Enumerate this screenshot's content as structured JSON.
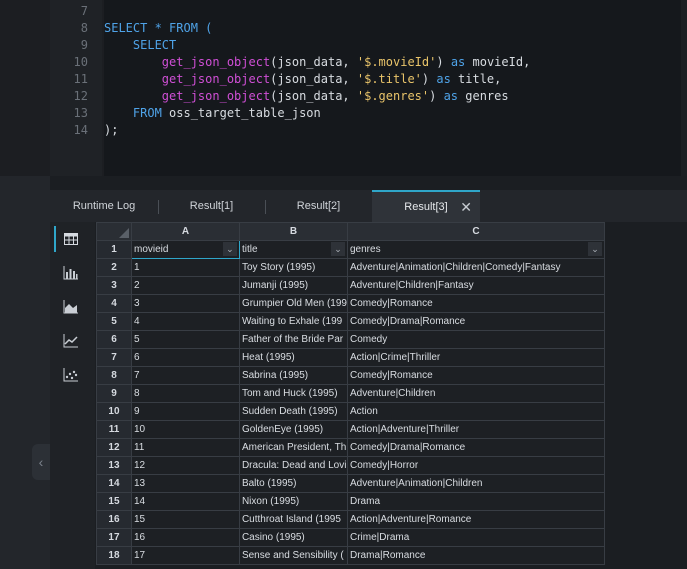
{
  "editor": {
    "line_numbers": [
      "7",
      "8",
      "9",
      "10",
      "11",
      "12",
      "13",
      "14"
    ],
    "lines": [
      [],
      [
        {
          "t": "SELECT * FROM (",
          "c": "kw"
        }
      ],
      [
        {
          "t": "    SELECT",
          "c": "kw"
        }
      ],
      [
        {
          "t": "        ",
          "c": ""
        },
        {
          "t": "get_json_object",
          "c": "fn"
        },
        {
          "t": "(json_data, ",
          "c": ""
        },
        {
          "t": "'$.movieId'",
          "c": "str"
        },
        {
          "t": ") ",
          "c": ""
        },
        {
          "t": "as",
          "c": "kw"
        },
        {
          "t": " movieId,",
          "c": ""
        }
      ],
      [
        {
          "t": "        ",
          "c": ""
        },
        {
          "t": "get_json_object",
          "c": "fn"
        },
        {
          "t": "(json_data, ",
          "c": ""
        },
        {
          "t": "'$.title'",
          "c": "str"
        },
        {
          "t": ") ",
          "c": ""
        },
        {
          "t": "as",
          "c": "kw"
        },
        {
          "t": " title,",
          "c": ""
        }
      ],
      [
        {
          "t": "        ",
          "c": ""
        },
        {
          "t": "get_json_object",
          "c": "fn"
        },
        {
          "t": "(json_data, ",
          "c": ""
        },
        {
          "t": "'$.genres'",
          "c": "str"
        },
        {
          "t": ") ",
          "c": ""
        },
        {
          "t": "as",
          "c": "kw"
        },
        {
          "t": " genres",
          "c": ""
        }
      ],
      [
        {
          "t": "    FROM",
          "c": "kw"
        },
        {
          "t": " oss_target_table_json",
          "c": ""
        }
      ],
      [
        {
          "t": ");",
          "c": ""
        }
      ]
    ]
  },
  "tabs": [
    {
      "label": "Runtime Log",
      "active": false
    },
    {
      "label": "Result[1]",
      "active": false
    },
    {
      "label": "Result[2]",
      "active": false
    },
    {
      "label": "Result[3]",
      "active": true
    }
  ],
  "tab_close_glyph": "✕",
  "side_tools": [
    "table-view-icon",
    "bar-chart-icon",
    "area-chart-icon",
    "line-chart-icon",
    "scatter-chart-icon"
  ],
  "grid": {
    "column_letters": [
      "A",
      "B",
      "C"
    ],
    "headers": [
      "movieid",
      "title",
      "genres"
    ],
    "dropdown_glyph": "⌄",
    "rows": [
      [
        "1",
        "Toy Story (1995)",
        "Adventure|Animation|Children|Comedy|Fantasy"
      ],
      [
        "2",
        "Jumanji (1995)",
        "Adventure|Children|Fantasy"
      ],
      [
        "3",
        "Grumpier Old Men (199",
        "Comedy|Romance"
      ],
      [
        "4",
        "Waiting to Exhale (199",
        "Comedy|Drama|Romance"
      ],
      [
        "5",
        "Father of the Bride Par",
        "Comedy"
      ],
      [
        "6",
        "Heat (1995)",
        "Action|Crime|Thriller"
      ],
      [
        "7",
        "Sabrina (1995)",
        "Comedy|Romance"
      ],
      [
        "8",
        "Tom and Huck (1995)",
        "Adventure|Children"
      ],
      [
        "9",
        "Sudden Death (1995)",
        "Action"
      ],
      [
        "10",
        "GoldenEye (1995)",
        "Action|Adventure|Thriller"
      ],
      [
        "11",
        "American President, Th",
        "Comedy|Drama|Romance"
      ],
      [
        "12",
        "Dracula: Dead and Lovi",
        "Comedy|Horror"
      ],
      [
        "13",
        "Balto (1995)",
        "Adventure|Animation|Children"
      ],
      [
        "14",
        "Nixon (1995)",
        "Drama"
      ],
      [
        "15",
        "Cutthroat Island (1995",
        "Action|Adventure|Romance"
      ],
      [
        "16",
        "Casino (1995)",
        "Crime|Drama"
      ],
      [
        "17",
        "Sense and Sensibility (",
        "Drama|Romance"
      ]
    ],
    "row_numbers": [
      "1",
      "2",
      "3",
      "4",
      "5",
      "6",
      "7",
      "8",
      "9",
      "10",
      "11",
      "12",
      "13",
      "14",
      "15",
      "16",
      "17",
      "18"
    ]
  },
  "collapse_glyph": "‹",
  "colors": {
    "accent": "#2fa6c9",
    "keyword": "#4fa3e8",
    "function": "#d04fd6",
    "string": "#e9c46a"
  }
}
